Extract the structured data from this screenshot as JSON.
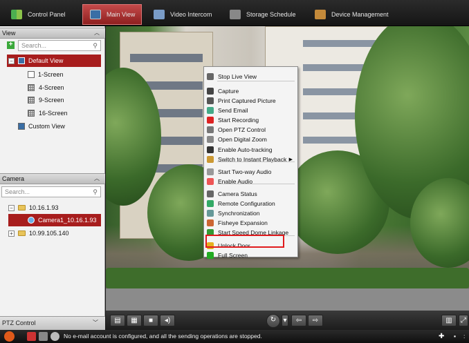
{
  "nav": {
    "tabs": [
      {
        "label": "Control Panel",
        "icon": "control-panel-icon",
        "active": false
      },
      {
        "label": "Main View",
        "icon": "main-view-icon",
        "active": true
      },
      {
        "label": "Video Intercom",
        "icon": "video-intercom-icon",
        "active": false
      },
      {
        "label": "Storage Schedule",
        "icon": "storage-schedule-icon",
        "active": false
      },
      {
        "label": "Device Management",
        "icon": "device-management-icon",
        "active": false
      }
    ]
  },
  "view_panel": {
    "title": "View",
    "search_placeholder": "Search...",
    "default_view": "Default View",
    "screens": [
      "1-Screen",
      "4-Screen",
      "9-Screen",
      "16-Screen"
    ],
    "custom_view": "Custom View"
  },
  "camera_panel": {
    "title": "Camera",
    "search_placeholder": "Search...",
    "groups": [
      {
        "label": "10.16.1.93",
        "expanded": true,
        "children": [
          "Camera1_10.16.1.93"
        ]
      },
      {
        "label": "10.99.105.140",
        "expanded": false,
        "children": []
      }
    ]
  },
  "ptz": {
    "title": "PTZ Control"
  },
  "context_menu": {
    "items": [
      {
        "label": "Stop Live View",
        "icon": "stop-live-view-icon"
      },
      {
        "label": "Capture",
        "icon": "capture-icon"
      },
      {
        "label": "Print Captured Picture",
        "icon": "print-icon"
      },
      {
        "label": "Send Email",
        "icon": "email-icon"
      },
      {
        "label": "Start Recording",
        "icon": "record-icon"
      },
      {
        "label": "Open PTZ Control",
        "icon": "ptz-icon"
      },
      {
        "label": "Open Digital Zoom",
        "icon": "zoom-icon"
      },
      {
        "label": "Enable Auto-tracking",
        "icon": "tracking-icon"
      },
      {
        "label": "Switch to Instant Playback",
        "icon": "playback-icon",
        "submenu": true
      },
      {
        "label": "Start Two-way Audio",
        "icon": "two-way-audio-icon"
      },
      {
        "label": "Enable Audio",
        "icon": "audio-icon"
      },
      {
        "label": "Camera Status",
        "icon": "camera-status-icon"
      },
      {
        "label": "Remote Configuration",
        "icon": "remote-config-icon"
      },
      {
        "label": "Synchronization",
        "icon": "sync-icon"
      },
      {
        "label": "Fisheye Expansion",
        "icon": "fisheye-icon"
      },
      {
        "label": "Start Speed Dome Linkage",
        "icon": "speed-dome-icon"
      },
      {
        "label": "Unlock Door",
        "icon": "unlock-door-icon",
        "highlighted": true
      },
      {
        "label": "Full Screen",
        "icon": "full-screen-icon"
      }
    ]
  },
  "status": {
    "message": "No e-mail account is configured, and all the sending operations are stopped."
  },
  "colors": {
    "accent": "#a71d1d",
    "highlight_box": "#e0191c"
  }
}
